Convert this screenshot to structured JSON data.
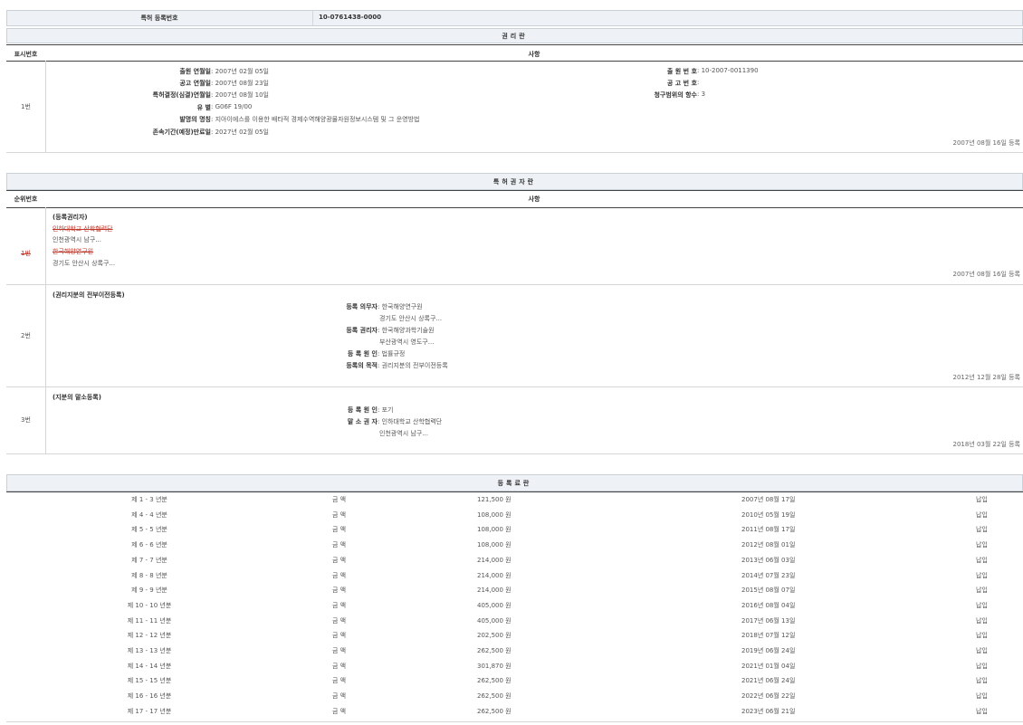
{
  "reg": {
    "label": "특허 등록번호",
    "value": "10-0761438-0000"
  },
  "rights": {
    "title": "권리란",
    "col_no": "표시번호",
    "col_matter": "사항",
    "row": {
      "no": "1번",
      "left": [
        {
          "label": "출원 연월일",
          "value": "2007년 02월 05일"
        },
        {
          "label": "공고 연월일",
          "value": "2007년 08월 23일"
        },
        {
          "label": "특허결정(심결)연월일",
          "value": "2007년 08월 10일"
        },
        {
          "label": "유 별",
          "value": "G06F 19/00"
        },
        {
          "label": "발명의 명칭",
          "value": "지아이에스를 이용한 배타적 경제수역해양광물자원정보시스템 및 그 운영방법"
        },
        {
          "label": "존속기간(예정)만료일",
          "value": "2027년 02월 05일"
        }
      ],
      "right": [
        {
          "label": "출 원 번 호",
          "value": "10-2007-0011390"
        },
        {
          "label": "공 고 번 호",
          "value": ""
        },
        {
          "label": "청구범위의 항수",
          "value": "3"
        }
      ],
      "date": "2007년 08월 16일 등록"
    }
  },
  "holders": {
    "title": "특허권자란",
    "col_no": "순위번호",
    "col_matter": "사항",
    "r1": {
      "no": "1번",
      "kind": "(등록권리자)",
      "lines": [
        "인하대학교 산학협력단",
        "인천광역시 남구...",
        "한국해양연구원",
        "경기도 안산시 상록구..."
      ],
      "date": "2007년 08월 16일 등록"
    },
    "r2": {
      "no": "2번",
      "kind": "(권리지분의 전부이전등록)",
      "items": [
        {
          "label": "등록 의무자",
          "value": "한국해양연구원"
        },
        {
          "label": "",
          "value": "경기도 안산시 상록구..."
        },
        {
          "label": "등록 권리자",
          "value": "한국해양과학기술원"
        },
        {
          "label": "",
          "value": "부산광역시 영도구..."
        },
        {
          "label": "등 록 원 인",
          "value": "법률규정"
        },
        {
          "label": "등록의 목적",
          "value": "권리지분의 전부이전등록"
        }
      ],
      "date": "2012년 12월 28일 등록"
    },
    "r3": {
      "no": "3번",
      "kind": "(지분의 말소등록)",
      "items": [
        {
          "label": "등 록 원 인",
          "value": "포기"
        },
        {
          "label": "말 소 권 자",
          "value": "인하대학교 산학협력단"
        },
        {
          "label": "",
          "value": "인천광역시 남구..."
        }
      ],
      "date": "2018년 03월 22일 등록"
    }
  },
  "fees": {
    "title": "등록료란",
    "amount_label": "금 액",
    "rows": [
      {
        "period": "제 1 - 3 년분",
        "amount": "121,500 원",
        "date": "2007년 08월 17일",
        "status": "납입"
      },
      {
        "period": "제 4 - 4 년분",
        "amount": "108,000 원",
        "date": "2010년 05월 19일",
        "status": "납입"
      },
      {
        "period": "제 5 - 5 년분",
        "amount": "108,000 원",
        "date": "2011년 08월 17일",
        "status": "납입"
      },
      {
        "period": "제 6 - 6 년분",
        "amount": "108,000 원",
        "date": "2012년 08월 01일",
        "status": "납입"
      },
      {
        "period": "제 7 - 7 년분",
        "amount": "214,000 원",
        "date": "2013년 06월 03일",
        "status": "납입"
      },
      {
        "period": "제 8 - 8 년분",
        "amount": "214,000 원",
        "date": "2014년 07월 23일",
        "status": "납입"
      },
      {
        "period": "제 9 - 9 년분",
        "amount": "214,000 원",
        "date": "2015년 08월 07일",
        "status": "납입"
      },
      {
        "period": "제 10 - 10 년분",
        "amount": "405,000 원",
        "date": "2016년 08월 04일",
        "status": "납입"
      },
      {
        "period": "제 11 - 11 년분",
        "amount": "405,000 원",
        "date": "2017년 06월 13일",
        "status": "납입"
      },
      {
        "period": "제 12 - 12 년분",
        "amount": "202,500 원",
        "date": "2018년 07월 12일",
        "status": "납입"
      },
      {
        "period": "제 13 - 13 년분",
        "amount": "262,500 원",
        "date": "2019년 06월 24일",
        "status": "납입"
      },
      {
        "period": "제 14 - 14 년분",
        "amount": "301,870 원",
        "date": "2021년 01월 04일",
        "status": "납입"
      },
      {
        "period": "제 15 - 15 년분",
        "amount": "262,500 원",
        "date": "2021년 06월 24일",
        "status": "납입"
      },
      {
        "period": "제 16 - 16 년분",
        "amount": "262,500 원",
        "date": "2022년 06월 22일",
        "status": "납입"
      },
      {
        "period": "제 17 - 17 년분",
        "amount": "262,500 원",
        "date": "2023년 06월 21일",
        "status": "납입"
      }
    ]
  }
}
